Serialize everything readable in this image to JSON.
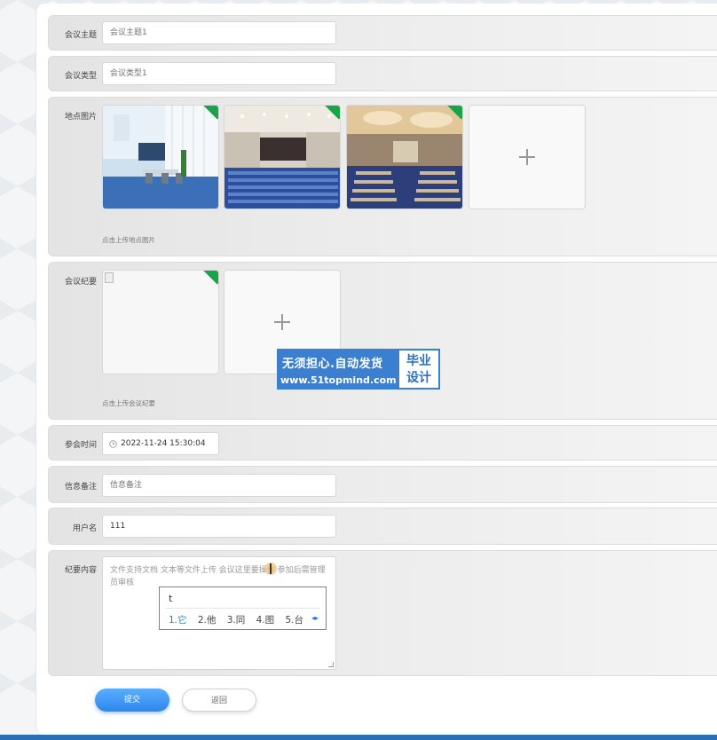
{
  "form": {
    "topic": {
      "label": "会议主题",
      "placeholder": "会议主题1"
    },
    "type": {
      "label": "会议类型",
      "placeholder": "会议类型1"
    },
    "location_images": {
      "label": "地点图片",
      "hint": "点击上传地点图片"
    },
    "minutes": {
      "label": "会议纪要",
      "hint": "点击上传会议纪要"
    },
    "time": {
      "label": "参会时间",
      "value": "2022-11-24 15:30:04"
    },
    "remark": {
      "label": "信息备注",
      "placeholder": "信息备注"
    },
    "username": {
      "label": "用户名",
      "value": "111"
    },
    "content": {
      "label": "纪要内容",
      "text": "文件支持文档 文本等文件上传 会议这里要操作 参加后需管理员审核"
    }
  },
  "ime": {
    "composition": "t",
    "candidates": [
      "1.它",
      "2.他",
      "3.同",
      "4.图",
      "5.台"
    ]
  },
  "watermark": {
    "line1": "无须担心.自动发货",
    "line2": "www.51topmind.com",
    "right1": "毕业",
    "right2": "设计"
  },
  "buttons": {
    "submit": "提交",
    "back": "返回"
  },
  "icons": {
    "plus": "plus-icon",
    "clock": "clock-icon",
    "resize": "resize-handle-icon"
  },
  "colors": {
    "primary": "#2f86ec",
    "upload_badge": "#1aa34a",
    "watermark": "#3a7fd0"
  }
}
